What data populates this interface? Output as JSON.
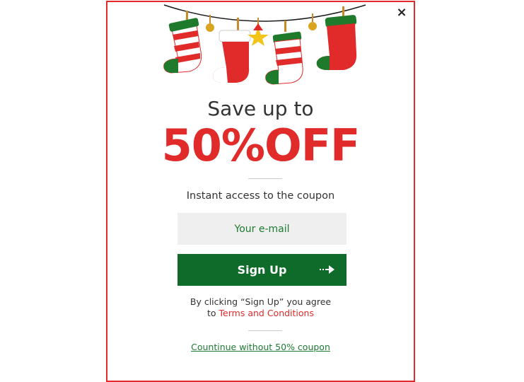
{
  "modal": {
    "close_label": "×",
    "headline": "Save up to",
    "offer": "50%OFF",
    "subtitle": "Instant  access to the coupon",
    "email_placeholder": "Your e-mail",
    "signup_label": "Sign Up",
    "terms_prefix": "By clicking “Sign Up” you agree",
    "terms_to": "to ",
    "terms_link": "Terms and Conditions",
    "continue_label": "Countinue without 50% coupon"
  },
  "colors": {
    "accent_red": "#e12b2b",
    "button_green": "#0e6b2a",
    "text_green": "#1d7a32",
    "input_bg": "#efefef"
  },
  "icons": {
    "close": "close-icon",
    "arrow": "arrow-right-icon",
    "decoration": "christmas-stockings-garland"
  }
}
